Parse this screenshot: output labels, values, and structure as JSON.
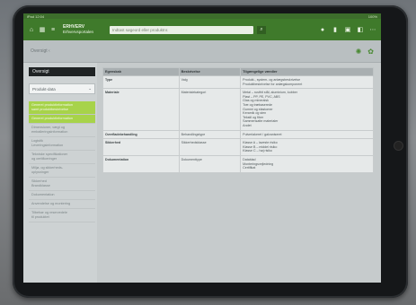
{
  "statusbar": {
    "left": "iPad  12:04",
    "right": "100%"
  },
  "header": {
    "brand_line1": "ERHVERV",
    "brand_line2": "Erhvervsportalen",
    "search_placeholder": "Indtast søgeord eller produktnr."
  },
  "toolbar": {
    "breadcrumb": "Oversigt ‹"
  },
  "sidebar": {
    "tab_label": "Oversigt",
    "select_value": "Produkt-data",
    "items": [
      {
        "line1": "Generel produktinformation",
        "line2": "samt produktbeskrivelse",
        "active": true
      },
      {
        "line1": "Generel produktinformation",
        "line2": "",
        "active": true
      },
      {
        "line1": "Dimensioner, vægt og",
        "line2": "emballeringsinformation",
        "active": false
      },
      {
        "line1": "Logistik",
        "line2": "Leveringsinformation",
        "active": false
      },
      {
        "line1": "Tekniske specifikationer",
        "line2": "og certificeringer",
        "active": false
      },
      {
        "line1": "Miljø- og sikkerheds-",
        "line2": "oplysninger",
        "active": false
      },
      {
        "line1": "Sikkerhed",
        "line2": "Brandklasse",
        "active": false
      },
      {
        "line1": "Dokumentation",
        "line2": "",
        "active": false
      },
      {
        "line1": "Anvendelse og montering",
        "line2": "",
        "active": false
      },
      {
        "line1": "Tilbehør og reservedele",
        "line2": "til produktet",
        "active": false
      }
    ]
  },
  "table": {
    "headers": [
      "Egenskab",
      "Beskrivelse",
      "Tilgængelige værdier"
    ],
    "rows": [
      {
        "cat": "Type",
        "desc": "Valg",
        "values": [
          "Produkt-, system- og anlægsbeskrivelse",
          "Produktbeskrivelse for anlægskomponent"
        ]
      },
      {
        "cat": "Materiale",
        "desc": "Materialekategori",
        "values": [
          "Metal – rustfrit stål, aluminium, kobber",
          "Plast – PP, PE, PVC, ABS",
          "Glas og mineralsk",
          "Træ og træbaserede",
          "Gummi og elastomer",
          "Keramik og sten",
          "Tekstil og fiber",
          "Sammensatte materialer",
          "Andet"
        ]
      },
      {
        "cat": "Overfladebehandling",
        "desc": "Behandlingstype",
        "values": [
          "Pulverlakeret / galvaniseret"
        ]
      },
      {
        "cat": "Sikkerhed",
        "desc": "Sikkerhedsklasse",
        "values": [
          "Klasse A – laveste risiko",
          "Klasse B – middel risiko",
          "Klasse C – høj risiko"
        ]
      },
      {
        "cat": "Dokumentation",
        "desc": "Dokumenttype",
        "values": [
          "Datablad",
          "Monteringsvejledning",
          "Certifikat"
        ]
      }
    ]
  }
}
